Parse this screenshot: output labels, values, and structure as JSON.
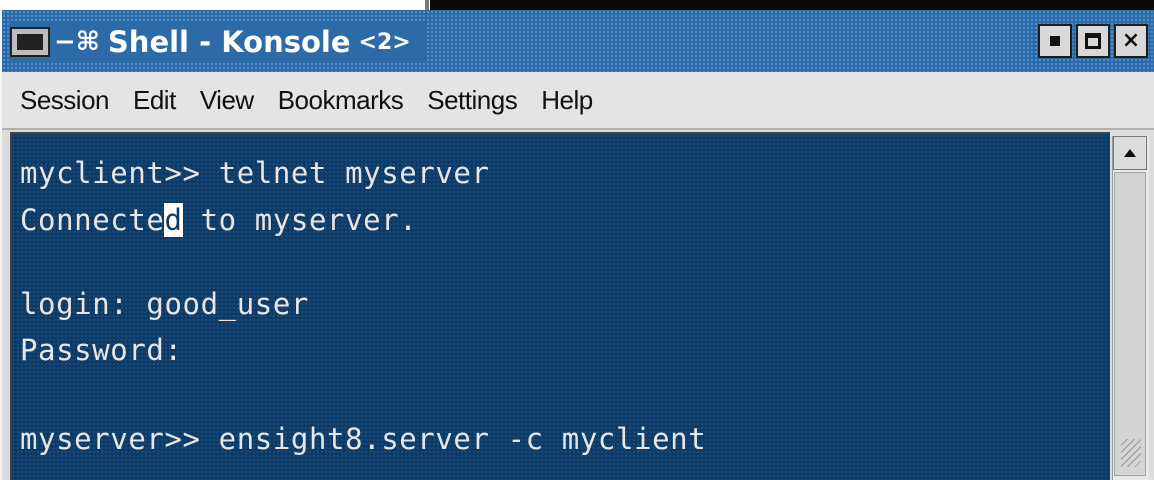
{
  "window": {
    "title": "Shell - Konsole",
    "title_suffix": "<2>",
    "sticky_icon": "−⌘",
    "buttons": {
      "minimize": "minimize",
      "maximize": "maximize",
      "close": "×"
    }
  },
  "menubar": {
    "items": [
      {
        "label": "Session"
      },
      {
        "label": "Edit"
      },
      {
        "label": "View"
      },
      {
        "label": "Bookmarks"
      },
      {
        "label": "Settings"
      },
      {
        "label": "Help"
      }
    ]
  },
  "terminal": {
    "lines": [
      "myclient>> telnet myserver",
      "Connected to myserver.",
      "",
      "login: good_user",
      "Password:",
      "",
      "myserver>> ensight8.server -c myclient"
    ],
    "cursor_line_before": "Connecte",
    "cursor_char": "d",
    "cursor_line_after": " to myserver."
  },
  "colors": {
    "titlebar": "#2d6aa8",
    "terminal_bg": "#0e3b66",
    "terminal_fg": "#e6e6e6"
  }
}
